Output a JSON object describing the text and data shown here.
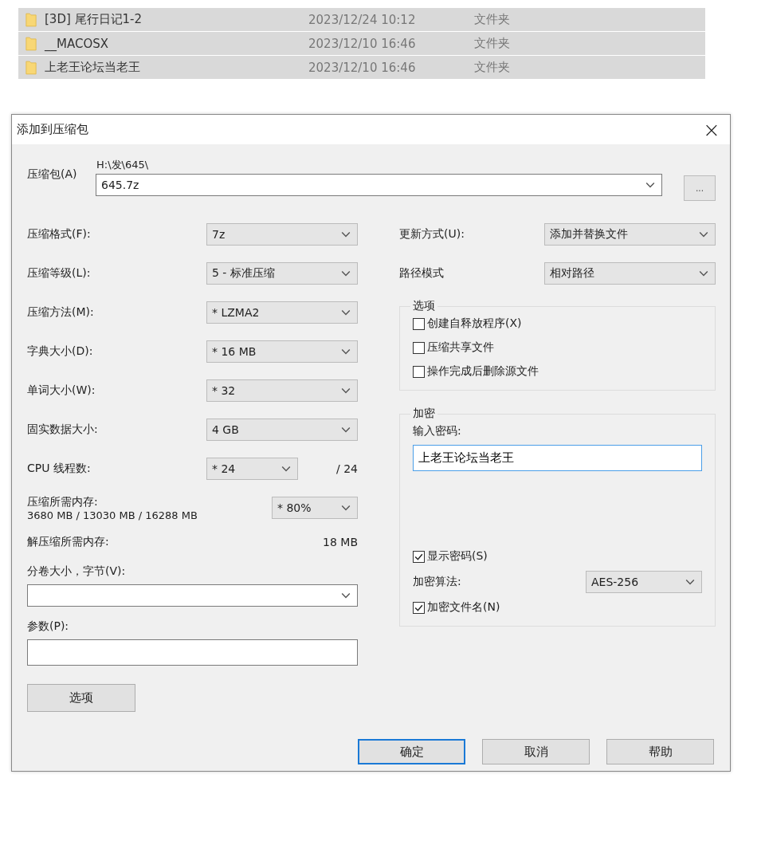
{
  "file_list": [
    {
      "name": "[3D] 尾行日记1-2",
      "date": "2023/12/24 10:12",
      "type": "文件夹",
      "selected": true
    },
    {
      "name": "__MACOSX",
      "date": "2023/12/10 16:46",
      "type": "文件夹",
      "selected": true
    },
    {
      "name": "上老王论坛当老王",
      "date": "2023/12/10 16:46",
      "type": "文件夹",
      "selected": true
    }
  ],
  "dialog": {
    "title": "添加到压缩包",
    "close": "×",
    "archive": {
      "label": "压缩包(A)",
      "path": "H:\\发\\645\\",
      "value": "645.7z",
      "browse": "..."
    },
    "left_rows": [
      {
        "kind": "select",
        "label": "压缩格式(F):",
        "value": "7z"
      },
      {
        "kind": "select",
        "label": "压缩等级(L):",
        "value": "5 - 标准压缩"
      },
      {
        "kind": "select",
        "label": "压缩方法(M):",
        "value": "* LZMA2"
      },
      {
        "kind": "select",
        "label": "字典大小(D):",
        "value": "* 16 MB"
      },
      {
        "kind": "select",
        "label": "单词大小(W):",
        "value": "* 32"
      },
      {
        "kind": "select",
        "label": "固实数据大小:",
        "value": "4 GB"
      },
      {
        "kind": "thread",
        "label": "CPU 线程数:",
        "value": "* 24",
        "reading": "/ 24"
      },
      {
        "kind": "memory",
        "label": "压缩所需内存:",
        "reading": "3680 MB / 13030 MB / 16288 MB",
        "value": "* 80%"
      },
      {
        "kind": "reading",
        "label": "解压缩所需内存:",
        "reading": "18 MB"
      }
    ],
    "volume": {
      "label": "分卷大小，字节(V):"
    },
    "params": {
      "label": "参数(P):"
    },
    "options_button": "选项",
    "update": {
      "label": "更新方式(U):",
      "value": "添加并替换文件"
    },
    "path_mode": {
      "label": "路径模式",
      "value": "相对路径"
    },
    "options_group": {
      "title": "选项",
      "items": [
        {
          "label": "创建自释放程序(X)",
          "checked": false
        },
        {
          "label": "压缩共享文件",
          "checked": false
        },
        {
          "label": "操作完成后删除源文件",
          "checked": false
        }
      ]
    },
    "encryption": {
      "title": "加密",
      "password_label": "输入密码:",
      "password": "上老王论坛当老王",
      "show_password": {
        "label": "显示密码(S)",
        "checked": true
      },
      "method": {
        "label": "加密算法:",
        "value": "AES-256"
      },
      "encrypt_names": {
        "label": "加密文件名(N)",
        "checked": true
      }
    },
    "buttons": [
      {
        "label": "确定",
        "default": true
      },
      {
        "label": "取消",
        "default": false
      },
      {
        "label": "帮助",
        "default": false
      }
    ]
  }
}
